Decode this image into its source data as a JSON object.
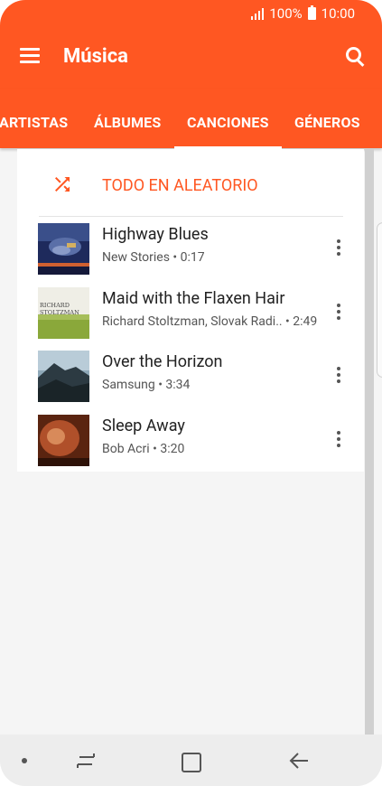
{
  "status_bar": {
    "battery_percent": "100%",
    "time": "10:00"
  },
  "toolbar": {
    "title": "Música"
  },
  "tabs": [
    {
      "label": "ARTISTAS"
    },
    {
      "label": "ÁLBUMES"
    },
    {
      "label": "CANCIONES"
    },
    {
      "label": "GÉNEROS"
    }
  ],
  "active_tab": "CANCIONES",
  "shuffle": {
    "label": "TODO EN ALEATORIO"
  },
  "songs": [
    {
      "title": "Highway Blues",
      "subtitle": "New Stories • 0:17"
    },
    {
      "title": "Maid with the Flaxen Hair",
      "subtitle": "Richard Stoltzman, Slovak Radi..  • 2:49",
      "art_text_1": "RICHARD",
      "art_text_2": "STOLTZMAN"
    },
    {
      "title": "Over the Horizon",
      "subtitle": "Samsung • 3:34"
    },
    {
      "title": "Sleep Away",
      "subtitle": "Bob Acri • 3:20"
    }
  ],
  "colors": {
    "accent": "#ff5722",
    "background": "#f5f5f5",
    "card": "#ffffff",
    "navbar": "#ededed"
  },
  "icons": [
    "signal-icon",
    "battery-icon",
    "menu-icon",
    "search-icon",
    "shuffle-icon",
    "more-vert-icon",
    "recent-apps-icon",
    "home-icon",
    "back-icon"
  ]
}
